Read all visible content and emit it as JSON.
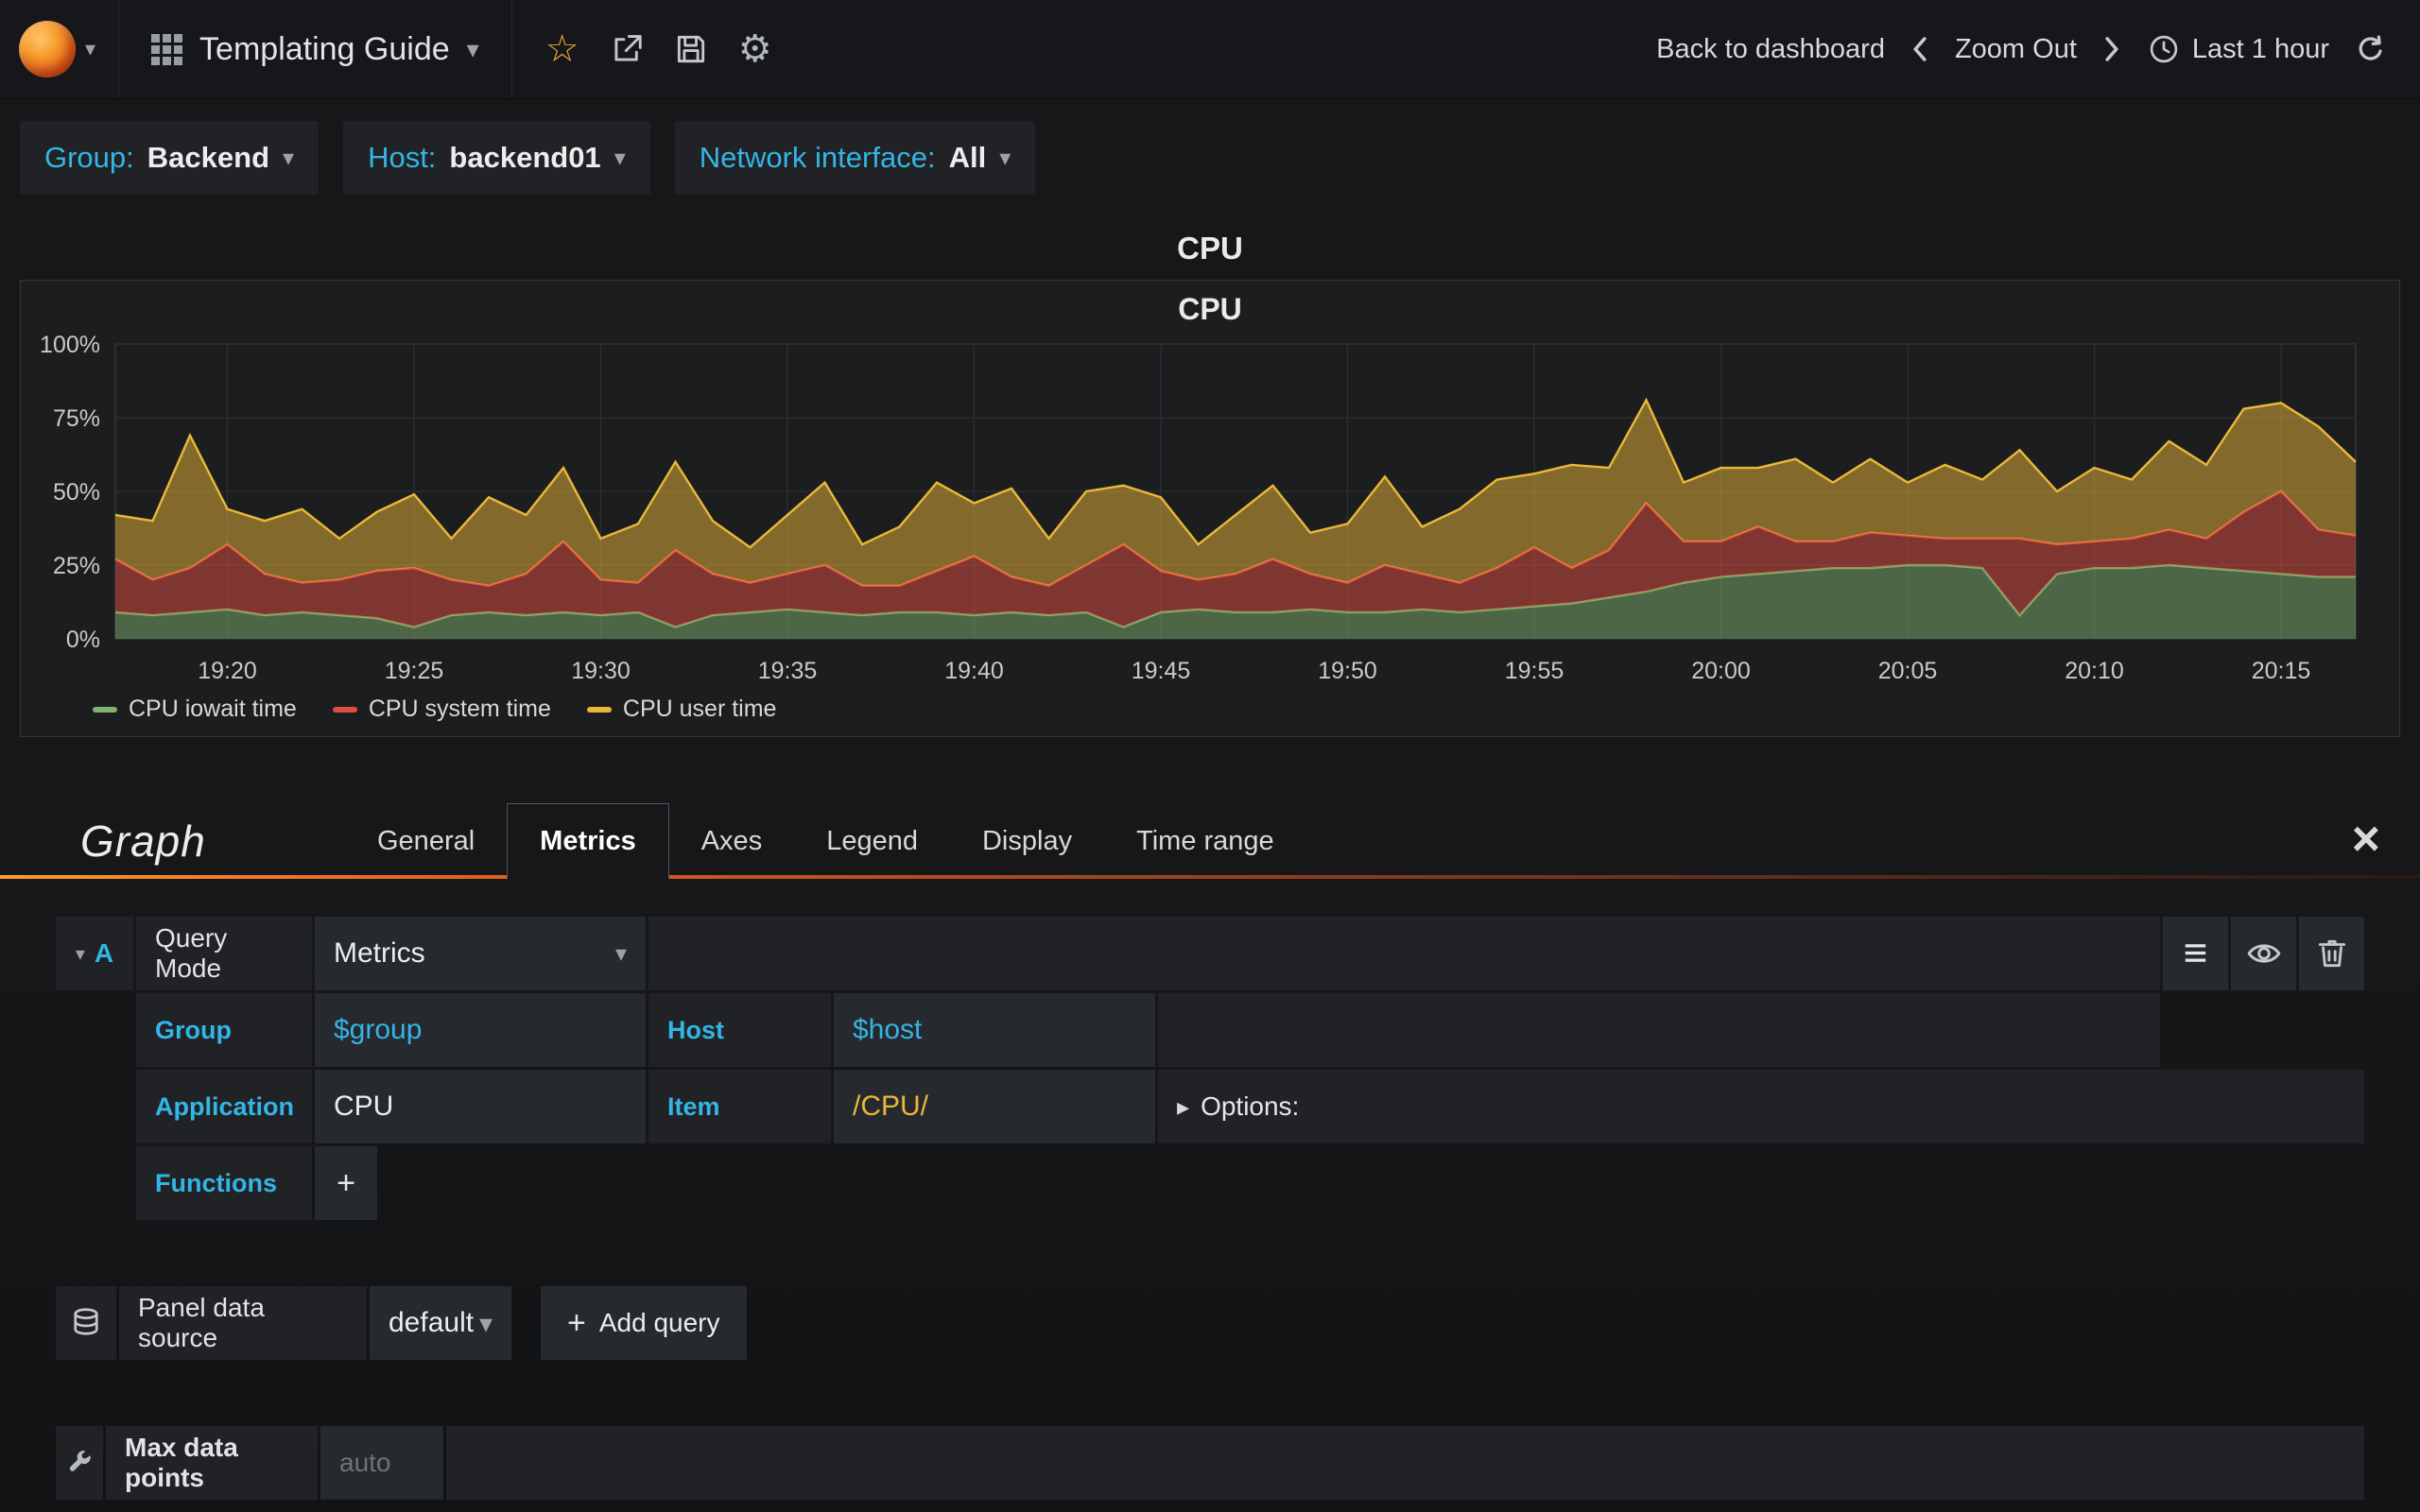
{
  "navbar": {
    "dashboard_title": "Templating Guide",
    "back_to_dashboard": "Back to dashboard",
    "zoom_out": "Zoom Out",
    "time_range": "Last 1 hour"
  },
  "variables": [
    {
      "label": "Group:",
      "value": "Backend"
    },
    {
      "label": "Host:",
      "value": "backend01"
    },
    {
      "label": "Network interface:",
      "value": "All"
    }
  ],
  "panel": {
    "title": "CPU",
    "graph_title": "CPU"
  },
  "chart_data": {
    "type": "area",
    "stacked": true,
    "title": "CPU",
    "xlabel": "",
    "ylabel": "",
    "ylim": [
      0,
      100
    ],
    "ytick_labels": [
      "0%",
      "25%",
      "50%",
      "75%",
      "100%"
    ],
    "x_start": "19:17",
    "x_end": "20:17",
    "x_interval_minutes": 1,
    "xtick_labels": [
      "19:20",
      "19:25",
      "19:30",
      "19:35",
      "19:40",
      "19:45",
      "19:50",
      "19:55",
      "20:00",
      "20:05",
      "20:10",
      "20:15"
    ],
    "xtick_indices": [
      3,
      8,
      13,
      18,
      23,
      28,
      33,
      38,
      43,
      48,
      53,
      58
    ],
    "grid": true,
    "legend_position": "bottom",
    "series": [
      {
        "name": "CPU iowait time",
        "color": "#7eb26d",
        "values": [
          9,
          8,
          9,
          10,
          8,
          9,
          8,
          7,
          4,
          8,
          9,
          8,
          9,
          8,
          9,
          4,
          8,
          9,
          10,
          9,
          8,
          9,
          9,
          8,
          9,
          8,
          9,
          4,
          9,
          10,
          9,
          9,
          10,
          9,
          9,
          10,
          9,
          10,
          11,
          12,
          14,
          16,
          19,
          21,
          22,
          23,
          24,
          24,
          25,
          25,
          24,
          8,
          22,
          24,
          24,
          25,
          24,
          23,
          22,
          21,
          21
        ]
      },
      {
        "name": "CPU system time",
        "color": "#e24d42",
        "values": [
          18,
          12,
          15,
          22,
          14,
          10,
          12,
          16,
          20,
          12,
          9,
          14,
          24,
          12,
          10,
          26,
          14,
          10,
          12,
          16,
          10,
          9,
          14,
          20,
          12,
          10,
          16,
          28,
          14,
          10,
          13,
          18,
          12,
          10,
          16,
          12,
          10,
          14,
          20,
          12,
          16,
          30,
          14,
          12,
          16,
          10,
          9,
          12,
          10,
          9,
          10,
          26,
          10,
          9,
          10,
          12,
          10,
          20,
          28,
          16,
          14
        ]
      },
      {
        "name": "CPU user time",
        "color": "#eab839",
        "values": [
          15,
          20,
          45,
          12,
          18,
          25,
          14,
          20,
          25,
          14,
          30,
          20,
          25,
          14,
          20,
          30,
          18,
          12,
          20,
          28,
          14,
          20,
          30,
          18,
          30,
          16,
          25,
          20,
          25,
          12,
          20,
          25,
          14,
          20,
          30,
          16,
          25,
          30,
          25,
          35,
          28,
          35,
          20,
          25,
          20,
          28,
          20,
          25,
          18,
          25,
          20,
          30,
          18,
          25,
          20,
          30,
          25,
          35,
          30,
          35,
          25
        ]
      }
    ]
  },
  "editor": {
    "panel_type_label": "Graph",
    "tabs": [
      "General",
      "Metrics",
      "Axes",
      "Legend",
      "Display",
      "Time range"
    ],
    "active_tab": "Metrics",
    "query": {
      "ref_id": "A",
      "query_mode_label": "Query Mode",
      "query_mode_value": "Metrics",
      "group_label": "Group",
      "group_value": "$group",
      "host_label": "Host",
      "host_value": "$host",
      "application_label": "Application",
      "application_value": "CPU",
      "item_label": "Item",
      "item_value": "/CPU/",
      "options_label": "Options:",
      "functions_label": "Functions"
    },
    "datasource": {
      "label": "Panel data source",
      "value": "default",
      "add_query_label": "Add query"
    },
    "settings": {
      "max_data_points_label": "Max data points",
      "max_data_points_placeholder": "auto"
    }
  }
}
